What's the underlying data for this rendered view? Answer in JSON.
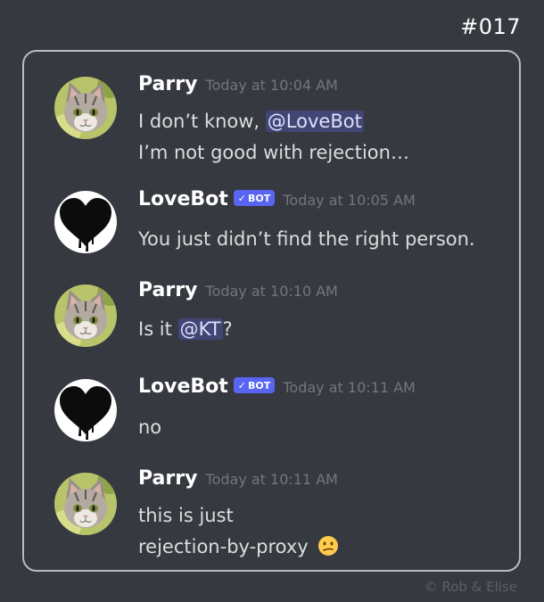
{
  "comic": {
    "number": "#017",
    "copyright": "©  Rob & Elise"
  },
  "messages": [
    {
      "author": "Parry",
      "timestamp": "Today at 10:04 AM",
      "line1_prefix": "I don’t know, ",
      "line1_mention": "@LoveBot",
      "line2": "I’m not good with rejection…"
    },
    {
      "author": "LoveBot",
      "bot_badge": "BOT",
      "timestamp": "Today at 10:05 AM",
      "text": "You just didn’t find the right person."
    },
    {
      "author": "Parry",
      "timestamp": "Today at 10:10 AM",
      "prefix": "Is it ",
      "mention": "@KT",
      "suffix": "?"
    },
    {
      "author": "LoveBot",
      "bot_badge": "BOT",
      "timestamp": "Today at 10:11 AM",
      "text": "no"
    },
    {
      "author": "Parry",
      "timestamp": "Today at 10:11 AM",
      "line1": "this is just",
      "line2": "rejection-by-proxy",
      "emoji": "😕"
    }
  ],
  "icons": {
    "parry_avatar": "kitten-avatar-icon",
    "lovebot_avatar": "black-heart-avatar-icon",
    "verified": "checkmark-icon",
    "emoji": "confused-face-icon"
  },
  "colors": {
    "background": "#36393f",
    "bot_badge": "#5865f2",
    "mention_bg": "#414675",
    "timestamp": "#72767d"
  }
}
